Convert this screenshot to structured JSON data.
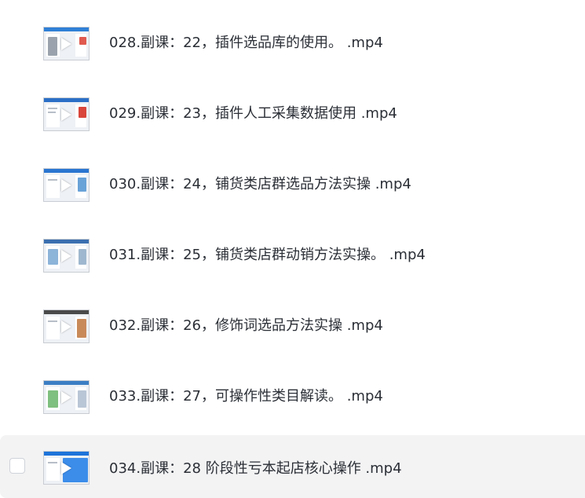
{
  "files": [
    {
      "name": "028.副课：22，插件选品库的使用。 .mp4",
      "thumb_bar": "#2f7fd6",
      "thumb_accent": "#e05a4f"
    },
    {
      "name": "029.副课：23，插件人工采集数据使用 .mp4",
      "thumb_bar": "#2b6fc7",
      "thumb_accent": "#d9463b"
    },
    {
      "name": "030.副课：24，铺货类店群选品方法实操 .mp4",
      "thumb_bar": "#2a75d1",
      "thumb_accent": "#6aa3d8"
    },
    {
      "name": "031.副课：25，铺货类店群动销方法实操。 .mp4",
      "thumb_bar": "#3b6fb0",
      "thumb_accent": "#8db4d9"
    },
    {
      "name": "032.副课：26，修饰词选品方法实操 .mp4",
      "thumb_bar": "#4a4a4a",
      "thumb_accent": "#c98a5a"
    },
    {
      "name": "033.副课：27，可操作性类目解读。 .mp4",
      "thumb_bar": "#3c7fc4",
      "thumb_accent": "#7fbf7f"
    },
    {
      "name": "034.副课：28 阶段性亏本起店核心操作 .mp4",
      "thumb_bar": "#1e73d9",
      "thumb_accent": "#3c8dea"
    }
  ],
  "selected_index": 6
}
